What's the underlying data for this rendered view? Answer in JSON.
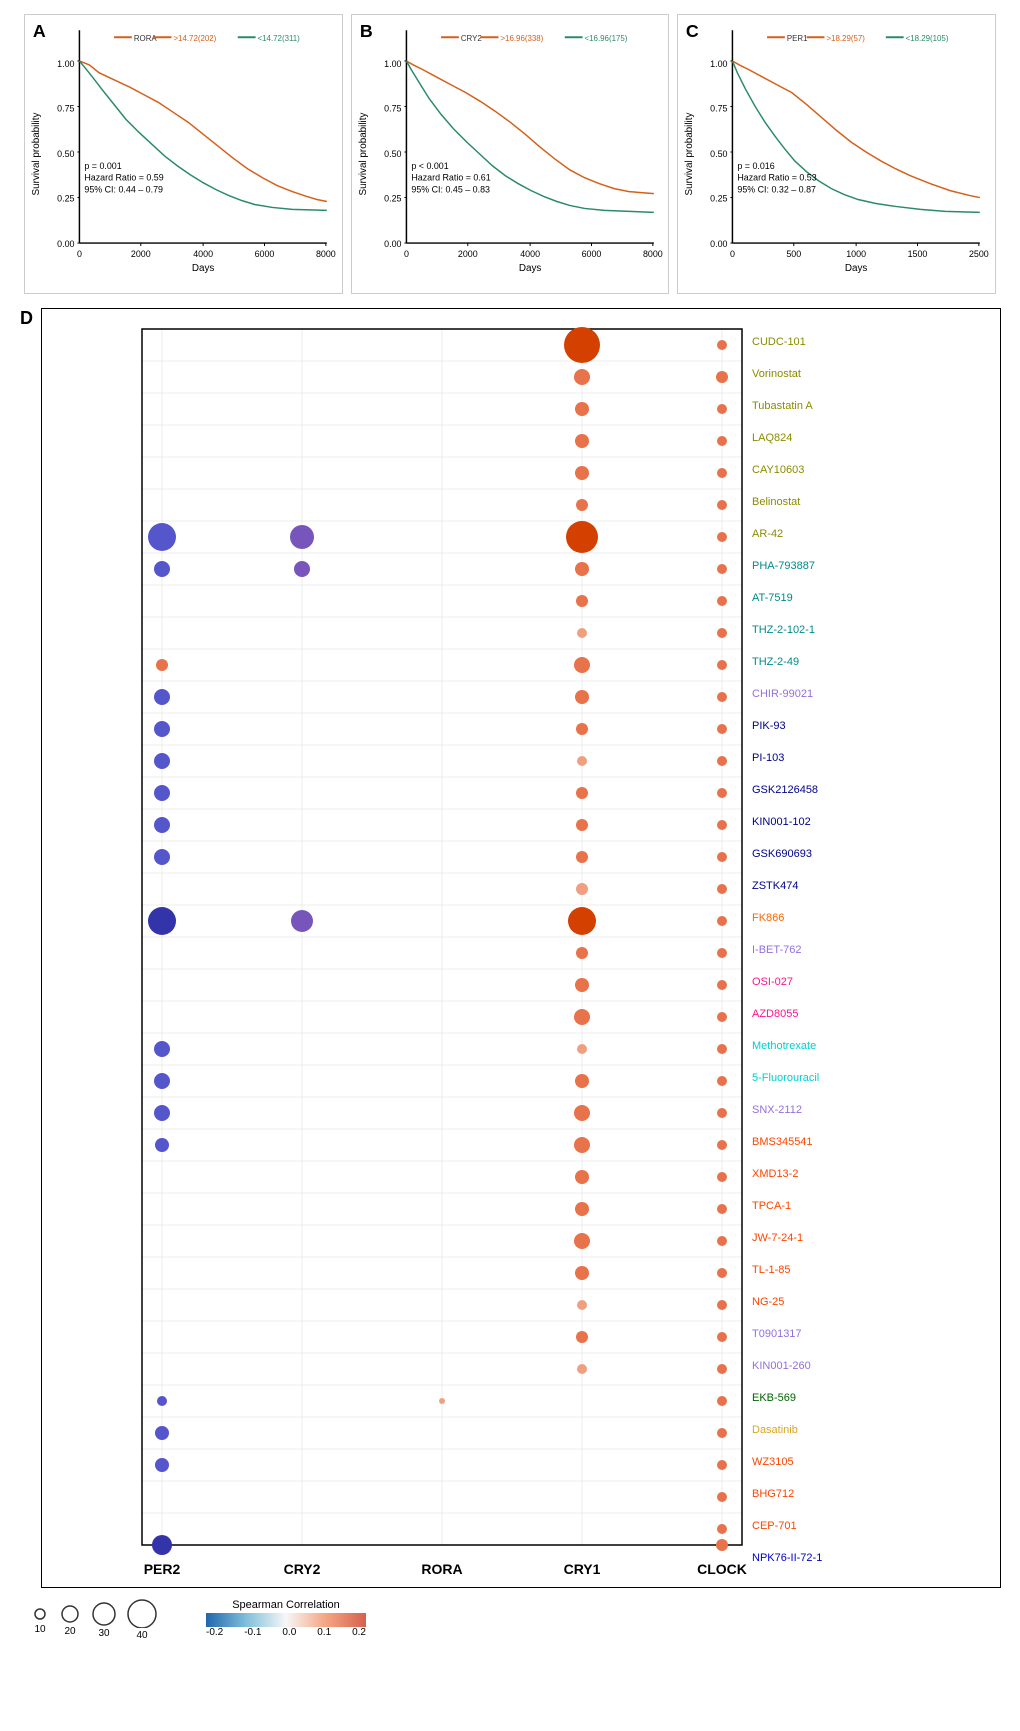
{
  "panels": {
    "A": {
      "label": "A",
      "gene": "RORA",
      "legend_high": ">14.72(202)",
      "legend_low": "<14.72(311)",
      "p_value": "p = 0.001",
      "hazard_ratio": "Hazard Ratio = 0.59",
      "ci": "95% CI: 0.44 – 0.79",
      "x_label": "Days",
      "y_label": "Survival probability",
      "color_high": "#d4601a",
      "color_low": "#2a8a6e"
    },
    "B": {
      "label": "B",
      "gene": "CRY2",
      "legend_high": ">16.96(338)",
      "legend_low": "<16.96(175)",
      "p_value": "p < 0.001",
      "hazard_ratio": "Hazard Ratio = 0.61",
      "ci": "95% CI: 0.45 – 0.83",
      "x_label": "Days",
      "y_label": "Survival probability",
      "color_high": "#d4601a",
      "color_low": "#2a8a6e"
    },
    "C": {
      "label": "C",
      "gene": "PER1",
      "legend_high": ">18.29(57)",
      "legend_low": "<18.29(105)",
      "p_value": "p = 0.016",
      "hazard_ratio": "Hazard Ratio = 0.53",
      "ci": "95% CI: 0.32 – 0.87",
      "x_label": "Days",
      "y_label": "Survival probability",
      "color_high": "#d4601a",
      "color_low": "#2a8a6e"
    }
  },
  "section_d_label": "D",
  "drugs": [
    {
      "name": "CUDC-101",
      "color": "#8B8B00"
    },
    {
      "name": "Vorinostat",
      "color": "#8B8B00"
    },
    {
      "name": "Tubastatin A",
      "color": "#8B8B00"
    },
    {
      "name": "LAQ824",
      "color": "#8B8B00"
    },
    {
      "name": "CAY10603",
      "color": "#8B8B00"
    },
    {
      "name": "Belinostat",
      "color": "#8B8B00"
    },
    {
      "name": "AR-42",
      "color": "#8B8B00"
    },
    {
      "name": "PHA-793887",
      "color": "#008B8B"
    },
    {
      "name": "AT-7519",
      "color": "#008B8B"
    },
    {
      "name": "THZ-2-102-1",
      "color": "#008B8B"
    },
    {
      "name": "THZ-2-49",
      "color": "#008B8B"
    },
    {
      "name": "CHIR-99021",
      "color": "#9370DB"
    },
    {
      "name": "PIK-93",
      "color": "#00008B"
    },
    {
      "name": "PI-103",
      "color": "#00008B"
    },
    {
      "name": "GSK2126458",
      "color": "#00008B"
    },
    {
      "name": "KIN001-102",
      "color": "#00008B"
    },
    {
      "name": "GSK690693",
      "color": "#00008B"
    },
    {
      "name": "ZSTK474",
      "color": "#00008B"
    },
    {
      "name": "FK866",
      "color": "#FF6600"
    },
    {
      "name": "I-BET-762",
      "color": "#9370DB"
    },
    {
      "name": "OSI-027",
      "color": "#FF1493"
    },
    {
      "name": "AZD8055",
      "color": "#FF1493"
    },
    {
      "name": "Methotrexate",
      "color": "#00CED1"
    },
    {
      "name": "5-Fluorouracil",
      "color": "#00CED1"
    },
    {
      "name": "SNX-2112",
      "color": "#9370DB"
    },
    {
      "name": "BMS345541",
      "color": "#FF4500"
    },
    {
      "name": "XMD13-2",
      "color": "#FF4500"
    },
    {
      "name": "TPCA-1",
      "color": "#FF4500"
    },
    {
      "name": "JW-7-24-1",
      "color": "#FF4500"
    },
    {
      "name": "TL-1-85",
      "color": "#FF4500"
    },
    {
      "name": "NG-25",
      "color": "#FF4500"
    },
    {
      "name": "T0901317",
      "color": "#9370DB"
    },
    {
      "name": "KIN001-260",
      "color": "#9370DB"
    },
    {
      "name": "EKB-569",
      "color": "#006400"
    },
    {
      "name": "Dasatinib",
      "color": "#DAA520"
    },
    {
      "name": "WZ3105",
      "color": "#FF4500"
    },
    {
      "name": "BHG712",
      "color": "#FF4500"
    },
    {
      "name": "CEP-701",
      "color": "#FF4500"
    },
    {
      "name": "NPK76-II-72-1",
      "color": "#0000CD"
    }
  ],
  "genes": [
    "PER2",
    "CRY2",
    "RORA",
    "CRY1",
    "CLOCK"
  ],
  "legend": {
    "size_label": "",
    "sizes": [
      {
        "value": "10",
        "r": 5
      },
      {
        "value": "20",
        "r": 8
      },
      {
        "value": "30",
        "r": 11
      },
      {
        "value": "40",
        "r": 14
      }
    ],
    "color_title": "Spearman Correlation",
    "color_min": "-0.2",
    "color_mid_low": "-0.1",
    "color_mid": "0.0",
    "color_mid_high": "0.1",
    "color_max": "0.2"
  }
}
